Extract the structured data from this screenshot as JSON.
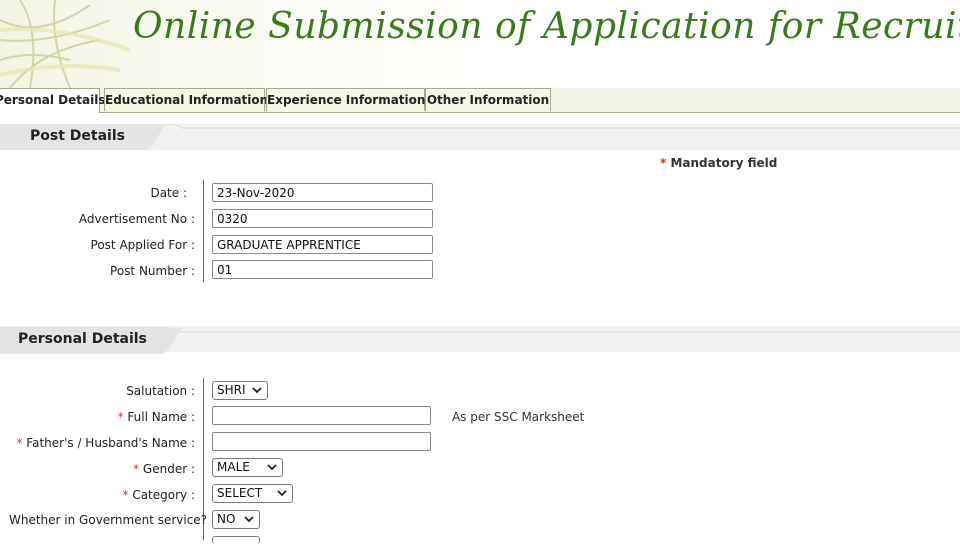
{
  "header": {
    "title": "Online Submission of Application for Recruitment"
  },
  "tabs": [
    {
      "label": "Personal Details",
      "active": true
    },
    {
      "label": "Educational Information",
      "active": false
    },
    {
      "label": "Experience Information",
      "active": false
    },
    {
      "label": "Other Information",
      "active": false
    }
  ],
  "post_details": {
    "heading": "Post Details",
    "mandatory_marker": "*",
    "mandatory_note": "Mandatory field",
    "fields": {
      "date": {
        "label": "Date :",
        "value": "23-Nov-2020"
      },
      "advt_no": {
        "label": "Advertisement No :",
        "value": "0320"
      },
      "post_applied": {
        "label": "Post Applied For :",
        "value": "GRADUATE APPRENTICE"
      },
      "post_number": {
        "label": "Post Number :",
        "value": "01"
      }
    }
  },
  "personal_details": {
    "heading": "Personal Details",
    "required_marker": "*",
    "fields": {
      "salutation": {
        "label": "Salutation :",
        "value": "SHRI"
      },
      "full_name": {
        "label": "Full Name :",
        "value": "",
        "note": "As per SSC Marksheet"
      },
      "father_name": {
        "label": "Father's / Husband's Name :",
        "value": ""
      },
      "gender": {
        "label": "Gender :",
        "value": "MALE"
      },
      "category": {
        "label": "Category :",
        "value": "SELECT"
      },
      "govt_service": {
        "label": "Whether in Government service?",
        "value": "NO"
      }
    }
  },
  "colors": {
    "title_green": "#3a7a1c",
    "required_red": "#d0392c",
    "tab_bg": "#f6f6e6"
  }
}
